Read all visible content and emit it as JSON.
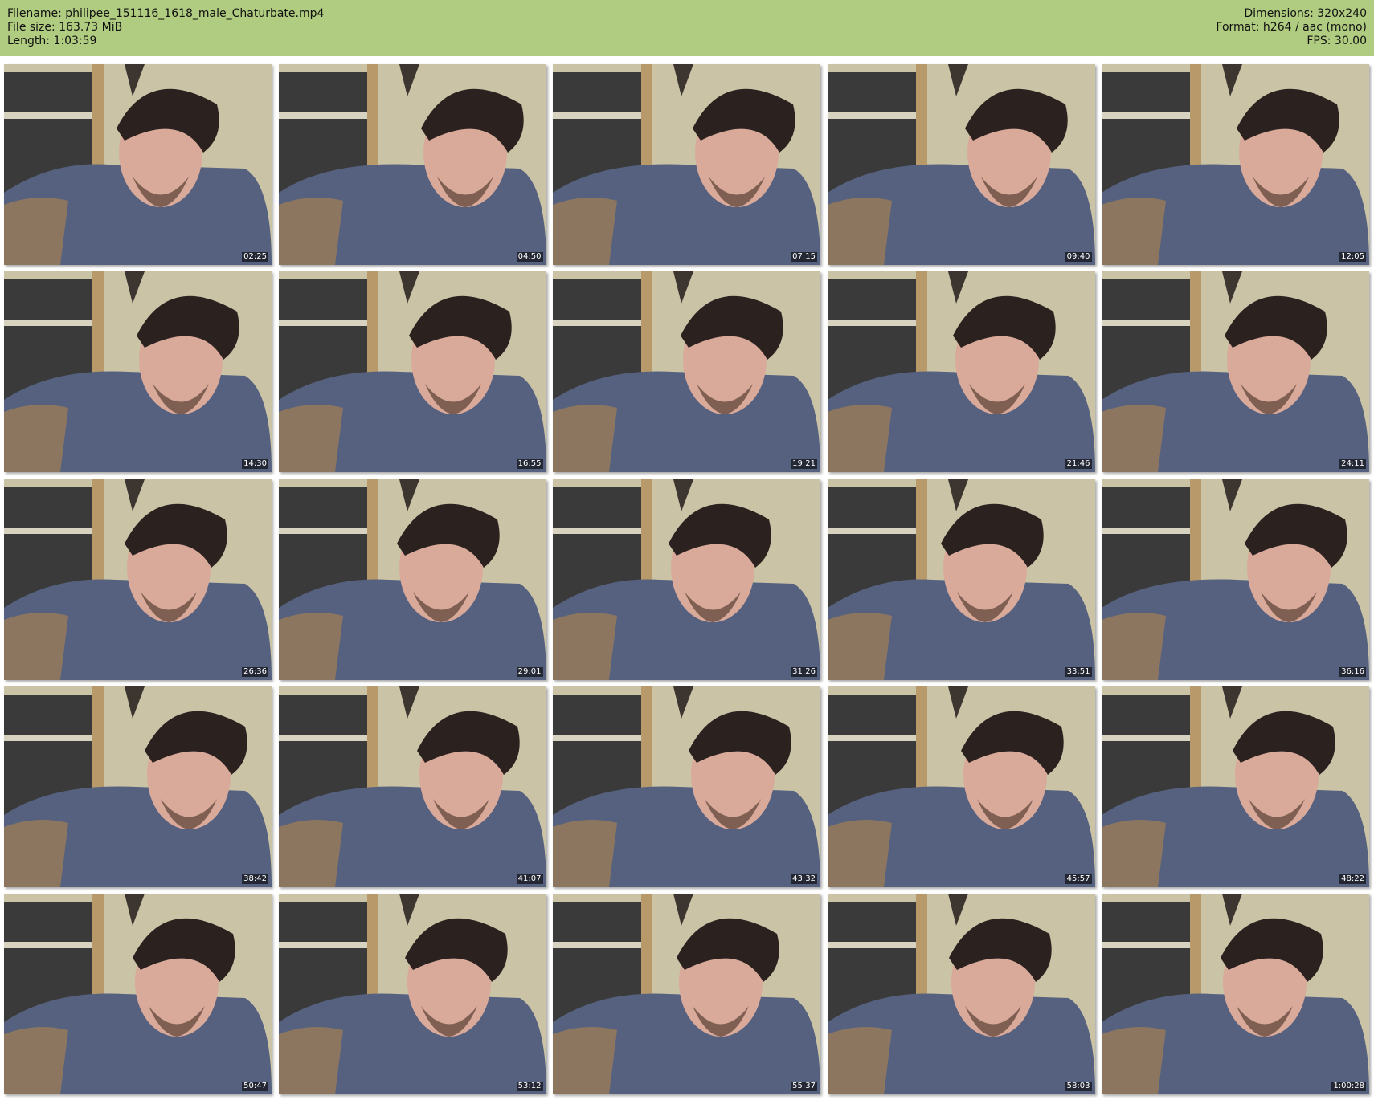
{
  "header": {
    "filename": "Filename: philipee_151116_1618_male_Chaturbate.mp4",
    "filesize": "File size: 163.73 MiB",
    "length": "Length: 1:03:59",
    "dimensions": "Dimensions: 320x240",
    "format": "Format: h264 / aac (mono)",
    "fps": "FPS: 30.00"
  },
  "colors": {
    "header_bg": "#b0cc80",
    "shirt": "#55617f",
    "wall": "#cbc3a6"
  },
  "thumbnails": [
    {
      "timestamp": "02:25"
    },
    {
      "timestamp": "04:50"
    },
    {
      "timestamp": "07:15"
    },
    {
      "timestamp": "09:40"
    },
    {
      "timestamp": "12:05"
    },
    {
      "timestamp": "14:30"
    },
    {
      "timestamp": "16:55"
    },
    {
      "timestamp": "19:21"
    },
    {
      "timestamp": "21:46"
    },
    {
      "timestamp": "24:11"
    },
    {
      "timestamp": "26:36"
    },
    {
      "timestamp": "29:01"
    },
    {
      "timestamp": "31:26"
    },
    {
      "timestamp": "33:51"
    },
    {
      "timestamp": "36:16"
    },
    {
      "timestamp": "38:42"
    },
    {
      "timestamp": "41:07"
    },
    {
      "timestamp": "43:32"
    },
    {
      "timestamp": "45:57"
    },
    {
      "timestamp": "48:22"
    },
    {
      "timestamp": "50:47"
    },
    {
      "timestamp": "53:12"
    },
    {
      "timestamp": "55:37"
    },
    {
      "timestamp": "58:03"
    },
    {
      "timestamp": "1:00:28"
    }
  ]
}
